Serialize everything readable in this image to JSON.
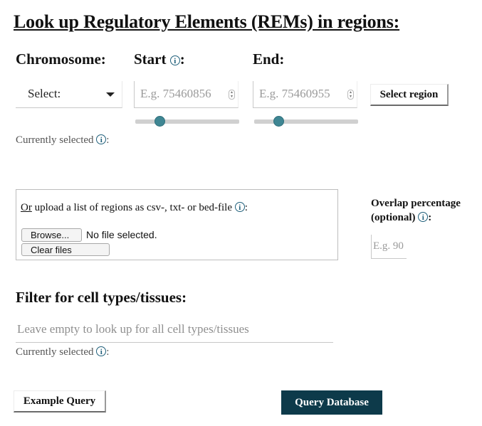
{
  "title": "Look up Regulatory Elements (REMs) in regions:",
  "region": {
    "chromosome_label": "Chromosome:",
    "chromosome_value": "Select:",
    "start_label": "Start",
    "start_placeholder": "E.g. 75460856",
    "end_label": "End:",
    "end_placeholder": "E.g. 75460955",
    "select_button": "Select region",
    "start_slider_fraction": 0.2,
    "end_slider_fraction": 0.2,
    "currently_selected": "Currently selected"
  },
  "upload": {
    "or": "Or",
    "text": " upload a list of regions as csv-, txt- or bed-file",
    "browse_button": "Browse...",
    "no_file": "No file selected.",
    "clear_button": "Clear files"
  },
  "overlap": {
    "label_line1": "Overlap percentage",
    "label_line2": "(optional)",
    "placeholder": "E.g. 90"
  },
  "filter": {
    "title": "Filter for cell types/tissues:",
    "placeholder": "Leave empty to look up for all cell types/tissues",
    "currently_selected": "Currently selected"
  },
  "actions": {
    "example_button": "Example Query",
    "query_button": "Query Database"
  },
  "icons": {
    "info": "info-icon",
    "caret": "chevron-down-icon"
  },
  "colors": {
    "accent": "#3f8693",
    "primary_button": "#0d3a4a",
    "info_icon": "#1f5f7a"
  }
}
